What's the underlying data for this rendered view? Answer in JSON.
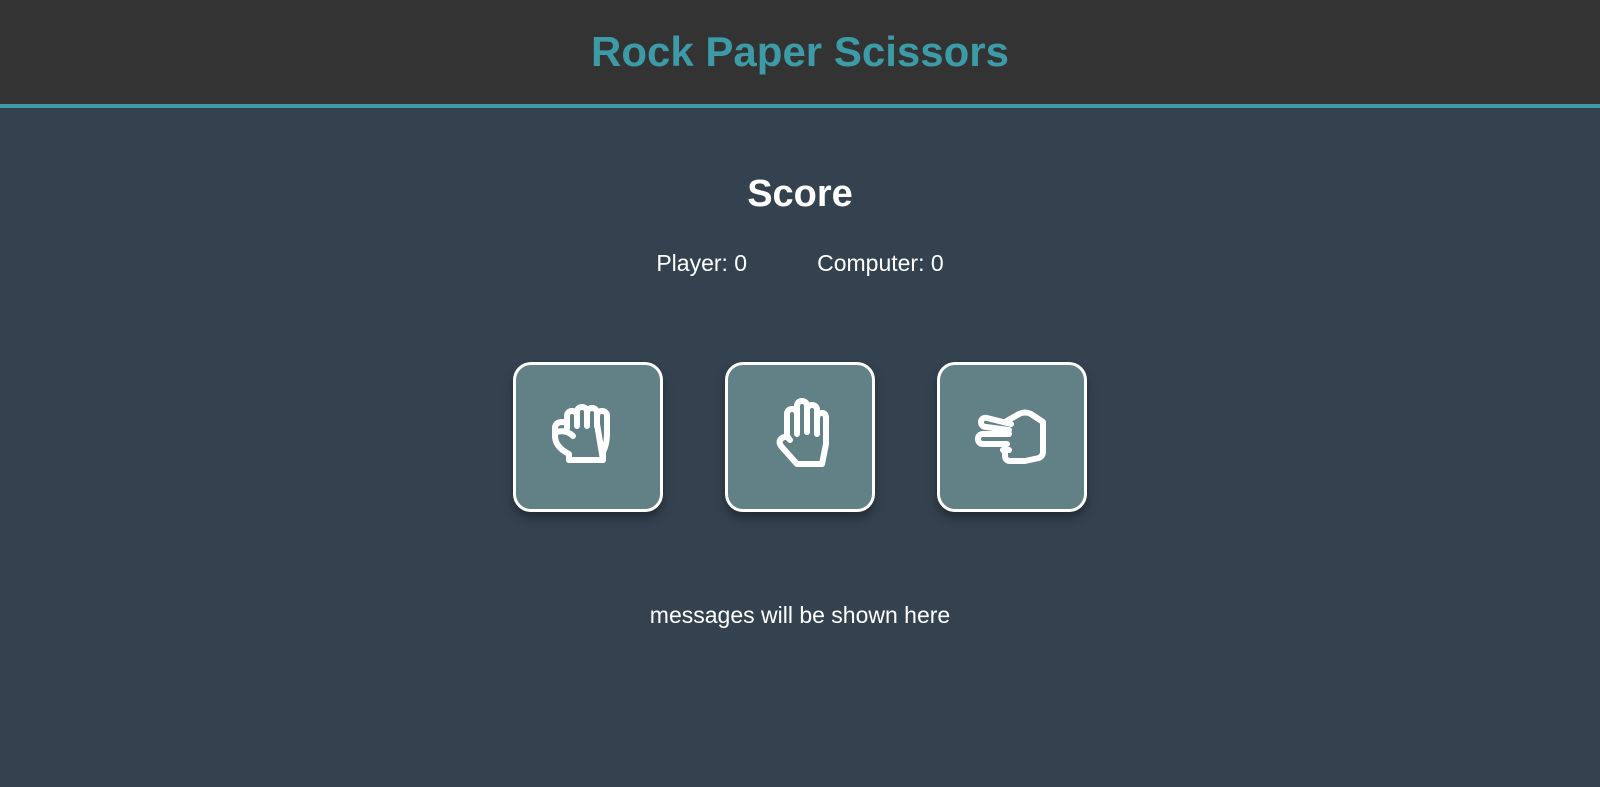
{
  "header": {
    "title": "Rock Paper Scissors"
  },
  "score": {
    "title": "Score",
    "player_label": "Player: 0",
    "computer_label": "Computer: 0"
  },
  "choices": [
    {
      "name": "rock",
      "icon": "hand-fist-icon"
    },
    {
      "name": "paper",
      "icon": "hand-open-icon"
    },
    {
      "name": "scissors",
      "icon": "hand-scissors-icon"
    }
  ],
  "message": "messages will be shown here",
  "colors": {
    "header_bg": "#333333",
    "accent": "#3d9aa7",
    "page_bg": "#344250",
    "button_bg": "#628186",
    "text": "#ffffff"
  }
}
